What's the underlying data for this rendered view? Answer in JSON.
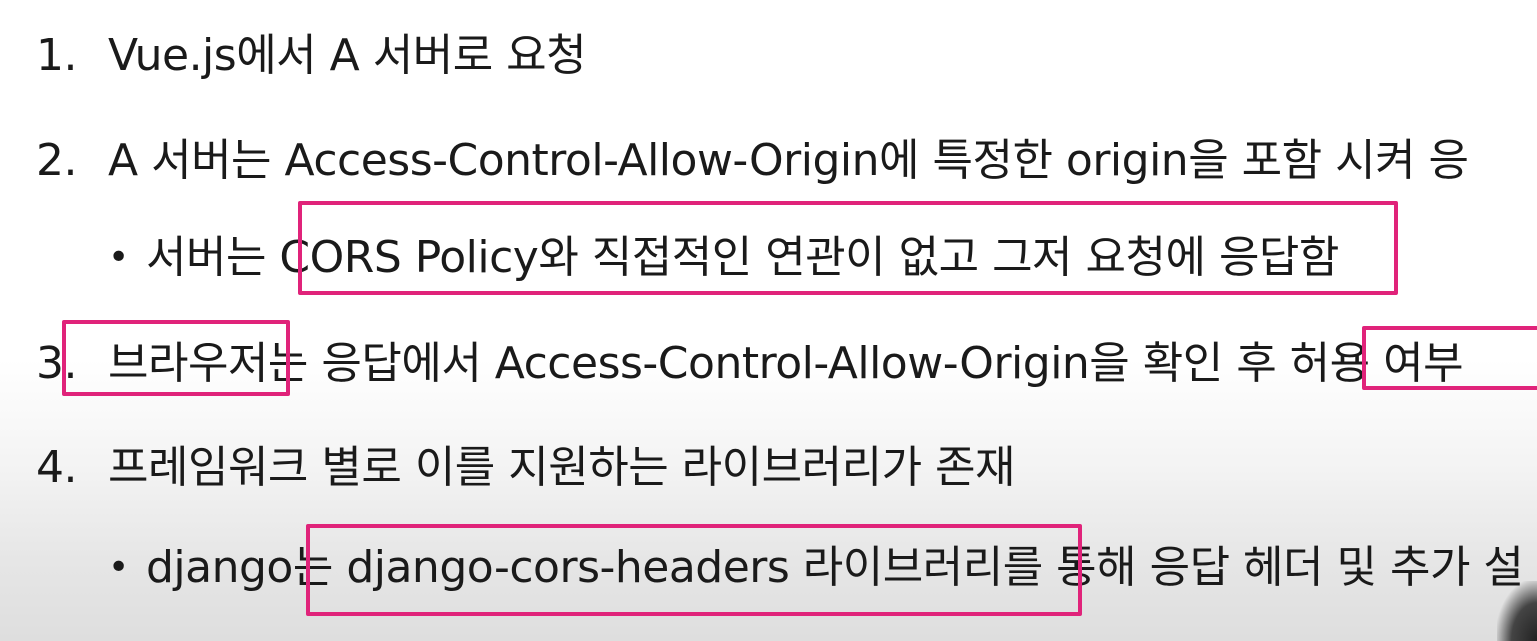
{
  "items": [
    {
      "number": "1.",
      "text": "Vue.js에서 A 서버로 요청"
    },
    {
      "number": "2.",
      "text": "A 서버는 Access-Control-Allow-Origin에 특정한 origin을 포함 시켜 응",
      "bullet": {
        "dot": "•",
        "text": "서버는 CORS Policy와 직접적인 연관이 없고 그저 요청에 응답함"
      }
    },
    {
      "number": "3.",
      "text": "브라우저는 응답에서 Access-Control-Allow-Origin을 확인 후 허용 여부"
    },
    {
      "number": "4.",
      "text": "프레임워크 별로 이를 지원하는 라이브러리가 존재",
      "bullet": {
        "dot": "•",
        "text": "django는 django-cors-headers 라이브러리를 통해 응답 헤더 및 추가 설"
      }
    }
  ],
  "highlight_color": "#e0237a"
}
